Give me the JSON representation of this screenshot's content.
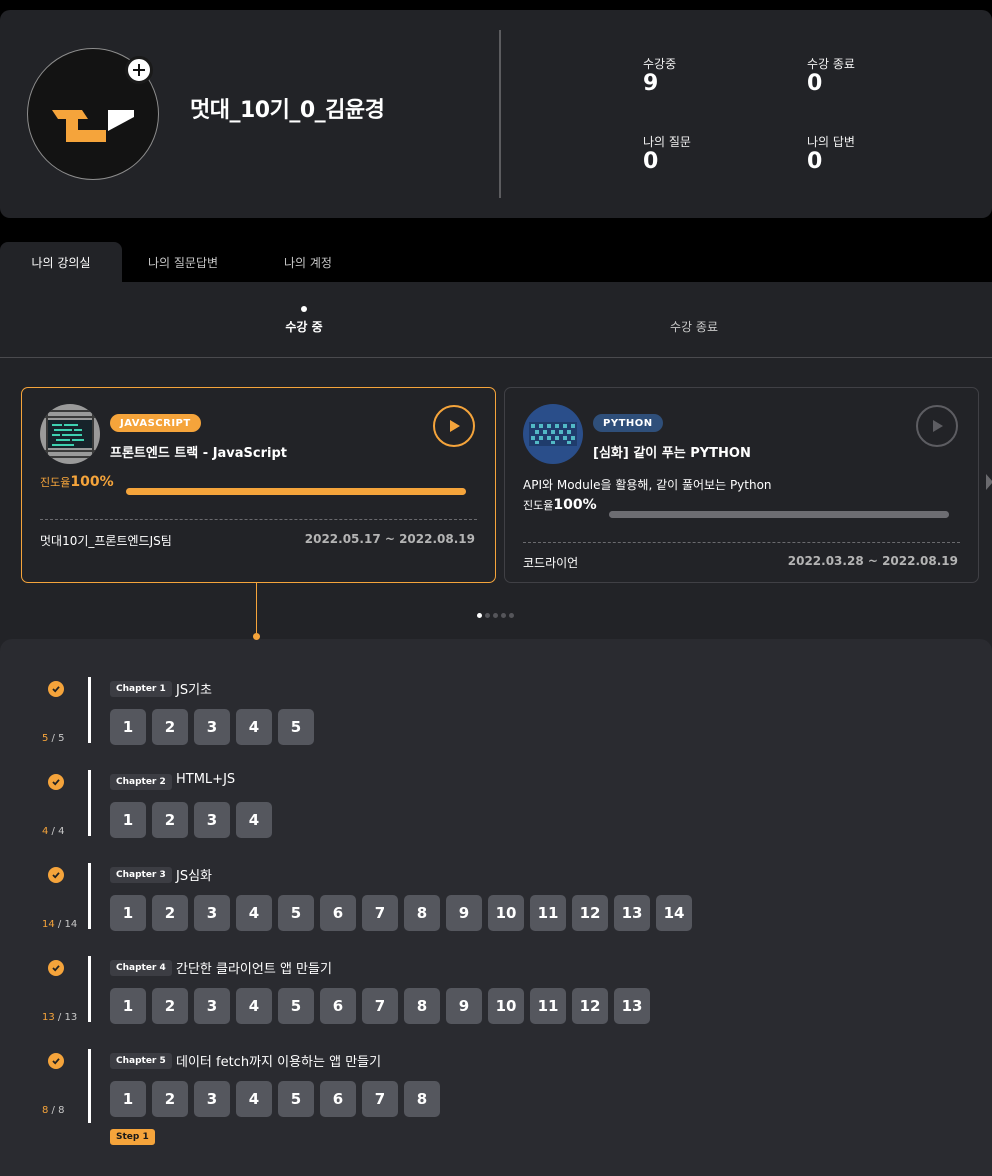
{
  "profile": {
    "name": "멋대_10기_0_김윤경",
    "stats": [
      {
        "label": "수강중",
        "value": "9"
      },
      {
        "label": "수강 종료",
        "value": "0"
      },
      {
        "label": "나의 질문",
        "value": "0"
      },
      {
        "label": "나의 답변",
        "value": "0"
      }
    ]
  },
  "tabs": [
    "나의 강의실",
    "나의 질문답변",
    "나의 계정"
  ],
  "subtabs": [
    "수강 중",
    "수강 종료"
  ],
  "courses": [
    {
      "badge": "JAVASCRIPT",
      "title": "프론트엔드 트랙 - JavaScript",
      "progress_label": "진도율",
      "progress_value": "100%",
      "progress": 1.0,
      "team": "멋대10기_프론트엔드JS팀",
      "dates": "2022.05.17 ~ 2022.08.19"
    },
    {
      "badge": "PYTHON",
      "title": "[심화] 같이 푸는 PYTHON",
      "description": "API와 Module을 활용해, 같이 풀어보는 Python",
      "progress_label": "진도율",
      "progress_value": "100%",
      "progress": 1.0,
      "team": "코드라이언",
      "dates": "2022.03.28 ~ 2022.08.19"
    }
  ],
  "chapters": [
    {
      "tag": "Chapter 1",
      "title": "JS기초",
      "done": "5",
      "total": "5",
      "lessons": [
        "1",
        "2",
        "3",
        "4",
        "5"
      ]
    },
    {
      "tag": "Chapter 2",
      "title": "HTML+JS",
      "done": "4",
      "total": "4",
      "lessons": [
        "1",
        "2",
        "3",
        "4"
      ]
    },
    {
      "tag": "Chapter 3",
      "title": "JS심화",
      "done": "14",
      "total": "14",
      "lessons": [
        "1",
        "2",
        "3",
        "4",
        "5",
        "6",
        "7",
        "8",
        "9",
        "10",
        "11",
        "12",
        "13",
        "14"
      ]
    },
    {
      "tag": "Chapter 4",
      "title": "간단한 클라이언트 앱 만들기",
      "done": "13",
      "total": "13",
      "lessons": [
        "1",
        "2",
        "3",
        "4",
        "5",
        "6",
        "7",
        "8",
        "9",
        "10",
        "11",
        "12",
        "13"
      ]
    },
    {
      "tag": "Chapter 5",
      "title": "데이터 fetch까지 이용하는 앱 만들기",
      "done": "8",
      "total": "8",
      "lessons": [
        "1",
        "2",
        "3",
        "4",
        "5",
        "6",
        "7",
        "8"
      ],
      "step": "Step 1"
    }
  ],
  "colors": {
    "accent": "#f5a43b",
    "python": "#2f4f7a",
    "panel": "#222327"
  },
  "icons": [
    "plus-icon",
    "play-icon",
    "check-icon",
    "chevron-right-icon"
  ]
}
